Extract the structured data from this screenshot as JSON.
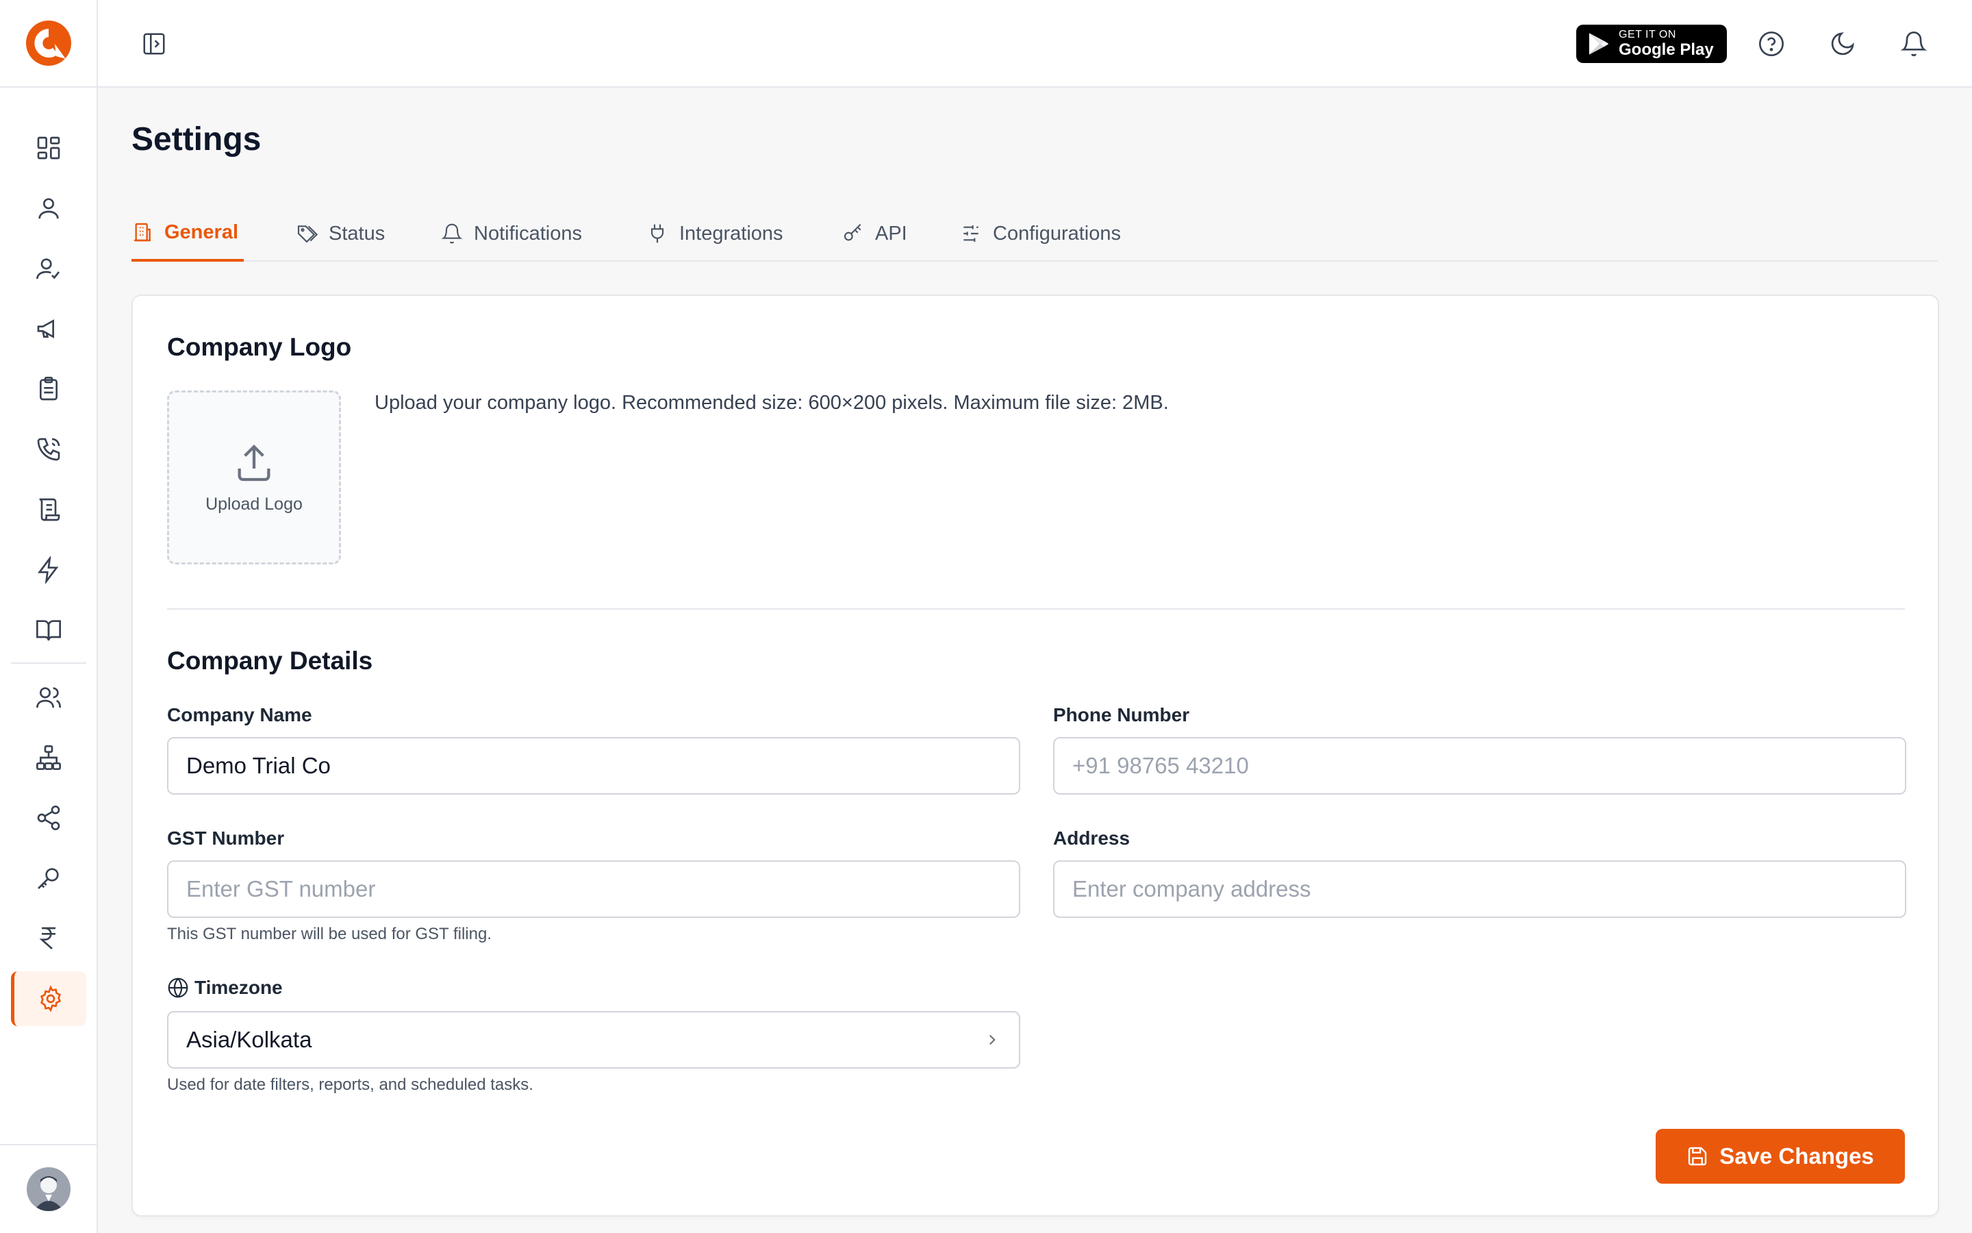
{
  "topbar": {
    "google_play": {
      "small": "GET IT ON",
      "big": "Google Play"
    }
  },
  "page": {
    "title": "Settings"
  },
  "tabs": [
    {
      "label": "General",
      "icon": "building-icon",
      "active": true
    },
    {
      "label": "Status",
      "icon": "tag-icon"
    },
    {
      "label": "Notifications",
      "icon": "bell-icon"
    },
    {
      "label": "Integrations",
      "icon": "plug-icon"
    },
    {
      "label": "API",
      "icon": "key-icon"
    },
    {
      "label": "Configurations",
      "icon": "sliders-icon"
    }
  ],
  "logo_section": {
    "title": "Company Logo",
    "upload_label": "Upload Logo",
    "description": "Upload your company logo. Recommended size: 600×200 pixels. Maximum file size: 2MB."
  },
  "details": {
    "title": "Company Details",
    "company_name": {
      "label": "Company Name",
      "value": "Demo Trial Co",
      "placeholder": ""
    },
    "phone": {
      "label": "Phone Number",
      "value": "",
      "placeholder": "+91 98765 43210"
    },
    "gst": {
      "label": "GST Number",
      "value": "",
      "placeholder": "Enter GST number",
      "hint": "This GST number will be used for GST filing."
    },
    "address": {
      "label": "Address",
      "value": "",
      "placeholder": "Enter company address"
    },
    "timezone": {
      "label": "Timezone",
      "value": "Asia/Kolkata",
      "hint": "Used for date filters, reports, and scheduled tasks."
    }
  },
  "actions": {
    "save_label": "Save Changes"
  },
  "colors": {
    "accent": "#ea580c",
    "active_bg": "#fff3ec",
    "border": "#e5e7eb"
  }
}
